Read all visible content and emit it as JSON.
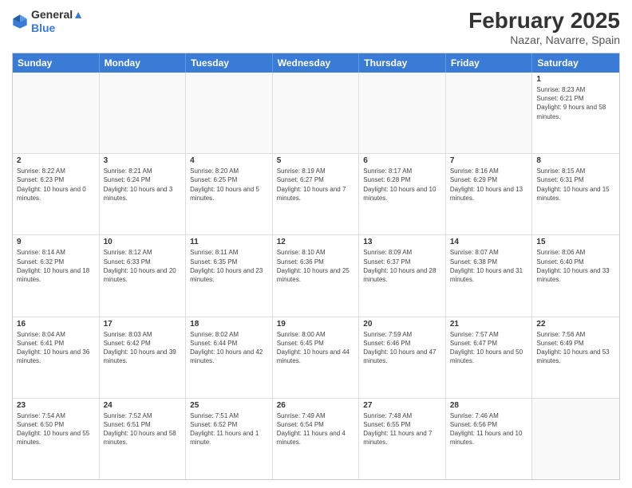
{
  "logo": {
    "line1": "General",
    "line2": "Blue"
  },
  "title": "February 2025",
  "location": "Nazar, Navarre, Spain",
  "days_of_week": [
    "Sunday",
    "Monday",
    "Tuesday",
    "Wednesday",
    "Thursday",
    "Friday",
    "Saturday"
  ],
  "weeks": [
    [
      {
        "day": "",
        "info": ""
      },
      {
        "day": "",
        "info": ""
      },
      {
        "day": "",
        "info": ""
      },
      {
        "day": "",
        "info": ""
      },
      {
        "day": "",
        "info": ""
      },
      {
        "day": "",
        "info": ""
      },
      {
        "day": "1",
        "info": "Sunrise: 8:23 AM\nSunset: 6:21 PM\nDaylight: 9 hours and 58 minutes."
      }
    ],
    [
      {
        "day": "2",
        "info": "Sunrise: 8:22 AM\nSunset: 6:23 PM\nDaylight: 10 hours and 0 minutes."
      },
      {
        "day": "3",
        "info": "Sunrise: 8:21 AM\nSunset: 6:24 PM\nDaylight: 10 hours and 3 minutes."
      },
      {
        "day": "4",
        "info": "Sunrise: 8:20 AM\nSunset: 6:25 PM\nDaylight: 10 hours and 5 minutes."
      },
      {
        "day": "5",
        "info": "Sunrise: 8:19 AM\nSunset: 6:27 PM\nDaylight: 10 hours and 7 minutes."
      },
      {
        "day": "6",
        "info": "Sunrise: 8:17 AM\nSunset: 6:28 PM\nDaylight: 10 hours and 10 minutes."
      },
      {
        "day": "7",
        "info": "Sunrise: 8:16 AM\nSunset: 6:29 PM\nDaylight: 10 hours and 13 minutes."
      },
      {
        "day": "8",
        "info": "Sunrise: 8:15 AM\nSunset: 6:31 PM\nDaylight: 10 hours and 15 minutes."
      }
    ],
    [
      {
        "day": "9",
        "info": "Sunrise: 8:14 AM\nSunset: 6:32 PM\nDaylight: 10 hours and 18 minutes."
      },
      {
        "day": "10",
        "info": "Sunrise: 8:12 AM\nSunset: 6:33 PM\nDaylight: 10 hours and 20 minutes."
      },
      {
        "day": "11",
        "info": "Sunrise: 8:11 AM\nSunset: 6:35 PM\nDaylight: 10 hours and 23 minutes."
      },
      {
        "day": "12",
        "info": "Sunrise: 8:10 AM\nSunset: 6:36 PM\nDaylight: 10 hours and 25 minutes."
      },
      {
        "day": "13",
        "info": "Sunrise: 8:09 AM\nSunset: 6:37 PM\nDaylight: 10 hours and 28 minutes."
      },
      {
        "day": "14",
        "info": "Sunrise: 8:07 AM\nSunset: 6:38 PM\nDaylight: 10 hours and 31 minutes."
      },
      {
        "day": "15",
        "info": "Sunrise: 8:06 AM\nSunset: 6:40 PM\nDaylight: 10 hours and 33 minutes."
      }
    ],
    [
      {
        "day": "16",
        "info": "Sunrise: 8:04 AM\nSunset: 6:41 PM\nDaylight: 10 hours and 36 minutes."
      },
      {
        "day": "17",
        "info": "Sunrise: 8:03 AM\nSunset: 6:42 PM\nDaylight: 10 hours and 39 minutes."
      },
      {
        "day": "18",
        "info": "Sunrise: 8:02 AM\nSunset: 6:44 PM\nDaylight: 10 hours and 42 minutes."
      },
      {
        "day": "19",
        "info": "Sunrise: 8:00 AM\nSunset: 6:45 PM\nDaylight: 10 hours and 44 minutes."
      },
      {
        "day": "20",
        "info": "Sunrise: 7:59 AM\nSunset: 6:46 PM\nDaylight: 10 hours and 47 minutes."
      },
      {
        "day": "21",
        "info": "Sunrise: 7:57 AM\nSunset: 6:47 PM\nDaylight: 10 hours and 50 minutes."
      },
      {
        "day": "22",
        "info": "Sunrise: 7:56 AM\nSunset: 6:49 PM\nDaylight: 10 hours and 53 minutes."
      }
    ],
    [
      {
        "day": "23",
        "info": "Sunrise: 7:54 AM\nSunset: 6:50 PM\nDaylight: 10 hours and 55 minutes."
      },
      {
        "day": "24",
        "info": "Sunrise: 7:52 AM\nSunset: 6:51 PM\nDaylight: 10 hours and 58 minutes."
      },
      {
        "day": "25",
        "info": "Sunrise: 7:51 AM\nSunset: 6:52 PM\nDaylight: 11 hours and 1 minute."
      },
      {
        "day": "26",
        "info": "Sunrise: 7:49 AM\nSunset: 6:54 PM\nDaylight: 11 hours and 4 minutes."
      },
      {
        "day": "27",
        "info": "Sunrise: 7:48 AM\nSunset: 6:55 PM\nDaylight: 11 hours and 7 minutes."
      },
      {
        "day": "28",
        "info": "Sunrise: 7:46 AM\nSunset: 6:56 PM\nDaylight: 11 hours and 10 minutes."
      },
      {
        "day": "",
        "info": ""
      }
    ]
  ]
}
